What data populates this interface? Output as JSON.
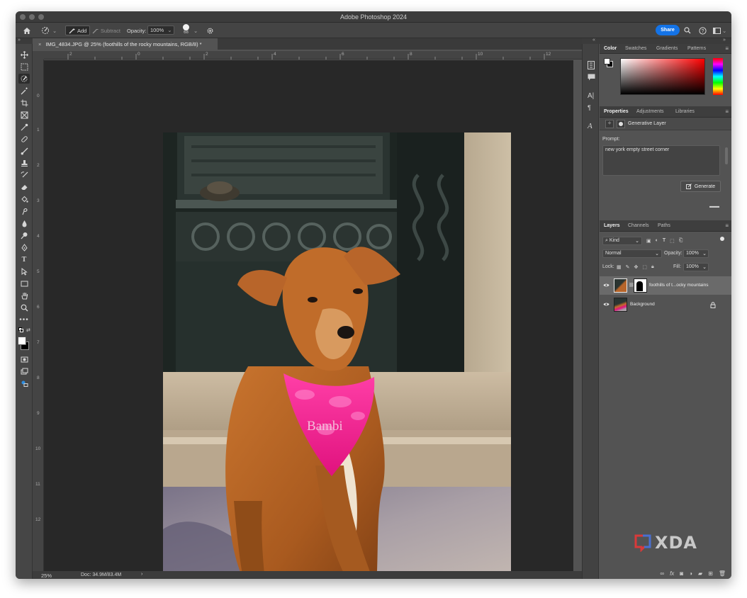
{
  "app": {
    "window_title": "Adobe Photoshop 2024"
  },
  "options_bar": {
    "add_label": "Add",
    "subtract_label": "Subtract",
    "opacity_label": "Opacity:",
    "opacity_value": "100%",
    "brush_size": "68",
    "share_label": "Share"
  },
  "document": {
    "tab_title": "IMG_4834.JPG @ 25% (foothills of the rocky mountains, RGB/8) *",
    "close_glyph": "×",
    "ruler_h_labels": [
      "2",
      "0",
      "2",
      "4",
      "6",
      "8",
      "10",
      "12"
    ],
    "ruler_v_labels": [
      "0",
      "1",
      "2",
      "3",
      "4",
      "5",
      "6",
      "7",
      "8",
      "9",
      "10",
      "11",
      "12"
    ],
    "bandana_text": "Bambi"
  },
  "status_bar": {
    "zoom": "25%",
    "doc_size": "Doc: 34.9M/83.4M",
    "arrow": "›"
  },
  "color_panel": {
    "tabs": [
      "Color",
      "Swatches",
      "Gradients",
      "Patterns"
    ],
    "active_tab": "Color",
    "hue_color": "#ff0000"
  },
  "properties_panel": {
    "tabs": [
      "Properties",
      "Adjustments",
      "Libraries"
    ],
    "active_tab": "Properties",
    "layer_type": "Generative Layer",
    "prompt_label": "Prompt:",
    "prompt_value": "new york empty street corner",
    "generate_label": "Generate"
  },
  "layers_panel": {
    "tabs": [
      "Layers",
      "Channels",
      "Paths"
    ],
    "active_tab": "Layers",
    "filter_kind": "Kind",
    "blend_mode": "Normal",
    "opacity_label": "Opacity:",
    "opacity_value": "100%",
    "lock_label": "Lock:",
    "fill_label": "Fill:",
    "fill_value": "100%",
    "layers": [
      {
        "name": "foothills of t...ocky mountains",
        "selected": true
      },
      {
        "name": "Background",
        "selected": false
      }
    ]
  },
  "watermark": {
    "text": "XDA"
  },
  "colors": {
    "accent": "#1473e6",
    "panel_bg": "#535353",
    "canvas_bg": "#282828"
  }
}
